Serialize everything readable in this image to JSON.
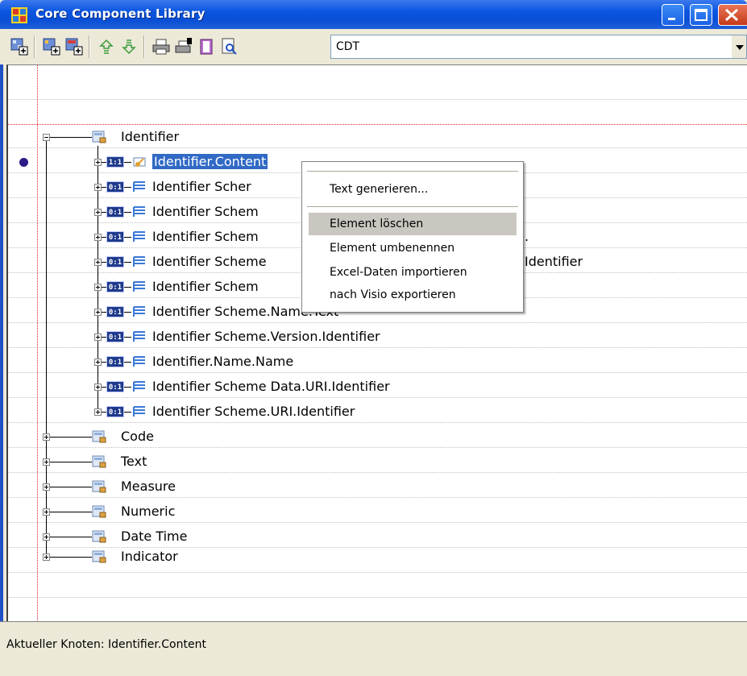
{
  "window": {
    "title": "Core Component Library",
    "colors": {
      "titlebar": "#0a55e0",
      "selection": "#316ac5",
      "menu_highlight": "#c9c7c0"
    }
  },
  "toolbar": {
    "icons": [
      "add-node-icon",
      "add-child-icon",
      "add-sibling-icon",
      "move-up-icon",
      "move-down-icon",
      "print-icon",
      "print-setup-icon",
      "book-icon",
      "preview-icon"
    ],
    "combo_value": "CDT"
  },
  "tree": {
    "root": {
      "label": "Identifier"
    },
    "children": [
      {
        "card": "1:1",
        "label": "Identifier.Content"
      },
      {
        "card": "0:1",
        "label": "Identifier  Scher"
      },
      {
        "card": "0:1",
        "label": "Identifier  Schem"
      },
      {
        "card": "0:1",
        "label": "Identifier  Schem",
        "suffix": "."
      },
      {
        "card": "0:1",
        "label": "Identifier  Scheme",
        "suffix": "Identifier"
      },
      {
        "card": "0:1",
        "label": "Identifier  Schem"
      },
      {
        "card": "0:1",
        "label": "Identifier  Scheme.Name.Text"
      },
      {
        "card": "0:1",
        "label": "Identifier Scheme.Version.Identifier"
      },
      {
        "card": "0:1",
        "label": "Identifier.Name.Name"
      },
      {
        "card": "0:1",
        "label": "Identifier  Scheme Data.URI.Identifier"
      },
      {
        "card": "0:1",
        "label": "Identifier Scheme.URI.Identifier"
      }
    ],
    "siblings": [
      "Code",
      "Text",
      "Measure",
      "Numeric",
      "Date Time",
      "Indicator"
    ]
  },
  "context_menu": {
    "items": [
      "Text generieren...",
      "Element löschen",
      "Element umbenennen",
      "Excel-Daten importieren",
      "nach Visio exportieren"
    ]
  },
  "status": {
    "text": "Aktueller Knoten: Identifier.Content"
  }
}
